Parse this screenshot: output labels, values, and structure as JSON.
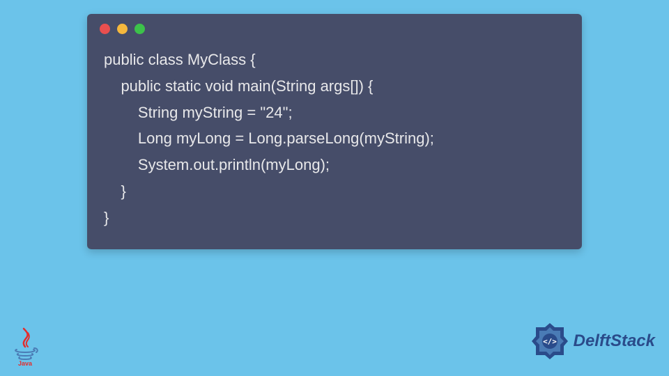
{
  "window": {
    "controls": [
      "close",
      "minimize",
      "maximize"
    ]
  },
  "code": {
    "lines": [
      "public class MyClass {",
      "    public static void main(String args[]) {",
      "        String myString = \"24\";",
      "        Long myLong = Long.parseLong(myString);",
      "        System.out.println(myLong);",
      "    }",
      "}"
    ]
  },
  "logos": {
    "java_label": "Java",
    "delft_label": "DelftStack"
  }
}
